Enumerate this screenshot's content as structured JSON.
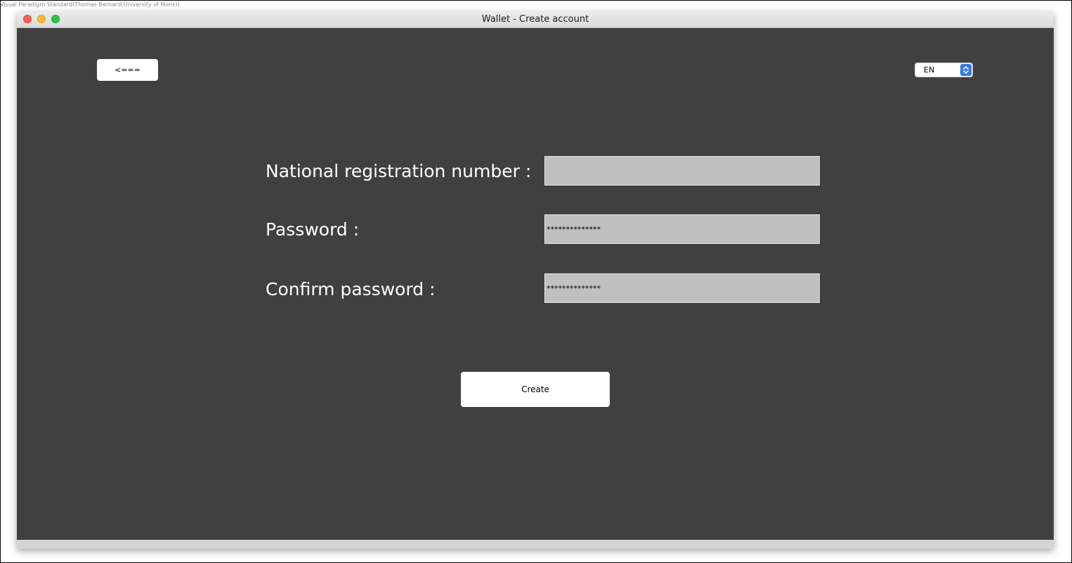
{
  "watermark": "Visual Paradigm Standard(Thomas Bernard(University of Mons))",
  "window": {
    "title": "Wallet - Create account"
  },
  "toolbar": {
    "back_label": "<===",
    "language": {
      "selected": "EN"
    }
  },
  "form": {
    "national_number": {
      "label": "National registration number :",
      "value": ""
    },
    "password": {
      "label": "Password :",
      "value": "**************"
    },
    "confirm_password": {
      "label": "Confirm password :",
      "value": "**************"
    },
    "create_label": "Create"
  },
  "colors": {
    "content_background": "#404040",
    "input_background": "#c0c0c0",
    "select_accent": "#2f7bf6"
  }
}
